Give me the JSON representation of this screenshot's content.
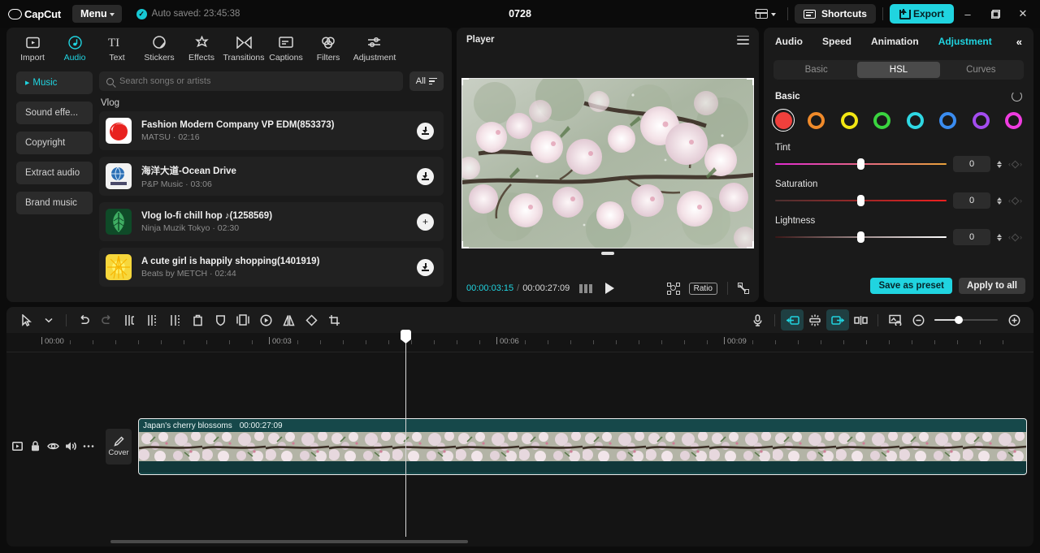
{
  "titlebar": {
    "brand": "CapCut",
    "menu_label": "Menu",
    "autosave_text": "Auto saved: 23:45:38",
    "project_title": "0728",
    "shortcuts_label": "Shortcuts",
    "export_label": "Export",
    "minimize": "–",
    "maximize": "❐",
    "close": "✕",
    "accent": "#20d4e0"
  },
  "media_tabs": [
    {
      "label": "Import",
      "icon": "import-icon",
      "active": false
    },
    {
      "label": "Audio",
      "icon": "audio-note-icon",
      "active": true
    },
    {
      "label": "Text",
      "icon": "text-icon",
      "active": false
    },
    {
      "label": "Stickers",
      "icon": "sticker-icon",
      "active": false
    },
    {
      "label": "Effects",
      "icon": "effects-star-icon",
      "active": false
    },
    {
      "label": "Transitions",
      "icon": "transitions-icon",
      "active": false
    },
    {
      "label": "Captions",
      "icon": "captions-icon",
      "active": false
    },
    {
      "label": "Filters",
      "icon": "filters-icon",
      "active": false
    },
    {
      "label": "Adjustment",
      "icon": "adjustment-sliders-icon",
      "active": false
    }
  ],
  "audio_sidebar": [
    {
      "label": "Music",
      "active": true
    },
    {
      "label": "Sound effe...",
      "active": false
    },
    {
      "label": "Copyright",
      "active": false
    },
    {
      "label": "Extract audio",
      "active": false
    },
    {
      "label": "Brand music",
      "active": false
    }
  ],
  "search": {
    "placeholder": "Search songs or artists",
    "filter_label": "All"
  },
  "song_group": "Vlog",
  "songs": [
    {
      "title": "Fashion Modern Company VP EDM(853373)",
      "artist": "MATSU",
      "duration": "02:16",
      "action": "download",
      "cover_kind": "red-swirl"
    },
    {
      "title": "海洋大道-Ocean Drive",
      "artist": "P&P Music",
      "duration": "03:06",
      "action": "download",
      "cover_kind": "blue-globe"
    },
    {
      "title": "Vlog  lo-fi chill hop ♪(1258569)",
      "artist": "Ninja Muzik Tokyo",
      "duration": "02:30",
      "action": "add",
      "cover_kind": "green-leaf"
    },
    {
      "title": "A cute girl is happily shopping(1401919)",
      "artist": "Beats by METCH",
      "duration": "02:44",
      "action": "download",
      "cover_kind": "yellow-burst"
    }
  ],
  "player": {
    "title": "Player",
    "current_time": "00:00:03:15",
    "separator": "/",
    "total_time": "00:00:27:09",
    "ratio_label": "Ratio"
  },
  "right_panel": {
    "tabs": [
      {
        "label": "Audio",
        "active": false
      },
      {
        "label": "Speed",
        "active": false
      },
      {
        "label": "Animation",
        "active": false
      },
      {
        "label": "Adjustment",
        "active": true
      }
    ],
    "collapse_icon": "«",
    "segments": [
      {
        "label": "Basic",
        "active": false
      },
      {
        "label": "HSL",
        "active": true
      },
      {
        "label": "Curves",
        "active": false
      }
    ],
    "section_label": "Basic",
    "swatches": [
      {
        "name": "red",
        "color": "#f0403c",
        "selected": true
      },
      {
        "name": "orange",
        "color": "#f08a2a",
        "selected": false
      },
      {
        "name": "yellow",
        "color": "#f2e613",
        "selected": false
      },
      {
        "name": "green",
        "color": "#3ad43f",
        "selected": false
      },
      {
        "name": "cyan",
        "color": "#2fd8e3",
        "selected": false
      },
      {
        "name": "blue",
        "color": "#3a8cf0",
        "selected": false
      },
      {
        "name": "purple",
        "color": "#a44cf0",
        "selected": false
      },
      {
        "name": "magenta",
        "color": "#ef3ce0",
        "selected": false
      }
    ],
    "sliders": [
      {
        "label": "Tint",
        "value": "0",
        "percent": 50,
        "grad_from": "#e02ad0",
        "grad_to": "#e8a23a"
      },
      {
        "label": "Saturation",
        "value": "0",
        "percent": 50,
        "grad_from": "#4a3030",
        "grad_to": "#f01f1f"
      },
      {
        "label": "Lightness",
        "value": "0",
        "percent": 50,
        "grad_from": "#3a1616",
        "grad_to": "#ffffff"
      }
    ],
    "save_preset_label": "Save as preset",
    "apply_all_label": "Apply to all"
  },
  "timeline": {
    "tools_left": [
      {
        "name": "select-cursor-icon",
        "state": "normal"
      },
      {
        "name": "cursor-dropdown-icon",
        "state": "normal"
      },
      {
        "name": "undo-icon",
        "state": "normal"
      },
      {
        "name": "redo-icon",
        "state": "disabled"
      },
      {
        "name": "split-icon",
        "state": "normal"
      },
      {
        "name": "trim-left-icon",
        "state": "normal"
      },
      {
        "name": "trim-right-icon",
        "state": "normal"
      },
      {
        "name": "delete-icon",
        "state": "normal"
      },
      {
        "name": "mask-shield-icon",
        "state": "normal"
      },
      {
        "name": "freeze-frame-icon",
        "state": "normal"
      },
      {
        "name": "reverse-icon",
        "state": "normal"
      },
      {
        "name": "mirror-icon",
        "state": "normal"
      },
      {
        "name": "rotate-icon",
        "state": "normal"
      },
      {
        "name": "crop-icon",
        "state": "normal"
      }
    ],
    "tools_right": [
      {
        "name": "record-mic-icon",
        "state": "normal"
      },
      {
        "name": "snap-left-icon",
        "state": "active"
      },
      {
        "name": "auto-adjust-icon",
        "state": "normal"
      },
      {
        "name": "snap-right-icon",
        "state": "active"
      },
      {
        "name": "split-track-icon",
        "state": "normal"
      },
      {
        "name": "thumbnail-view-icon",
        "state": "normal"
      },
      {
        "name": "zoom-out-icon",
        "state": "normal"
      },
      {
        "name": "zoom-in-icon",
        "state": "normal"
      }
    ],
    "ruler_labels": [
      "00:00",
      "00:03",
      "00:06",
      "00:09"
    ],
    "zoom_percent": 38,
    "cover_label": "Cover",
    "track_controls": [
      "track-type-icon",
      "lock-icon",
      "eye-icon",
      "volume-icon",
      "more-icon"
    ],
    "clip": {
      "name": "Japan's cherry blossoms",
      "duration": "00:00:27:09"
    }
  }
}
